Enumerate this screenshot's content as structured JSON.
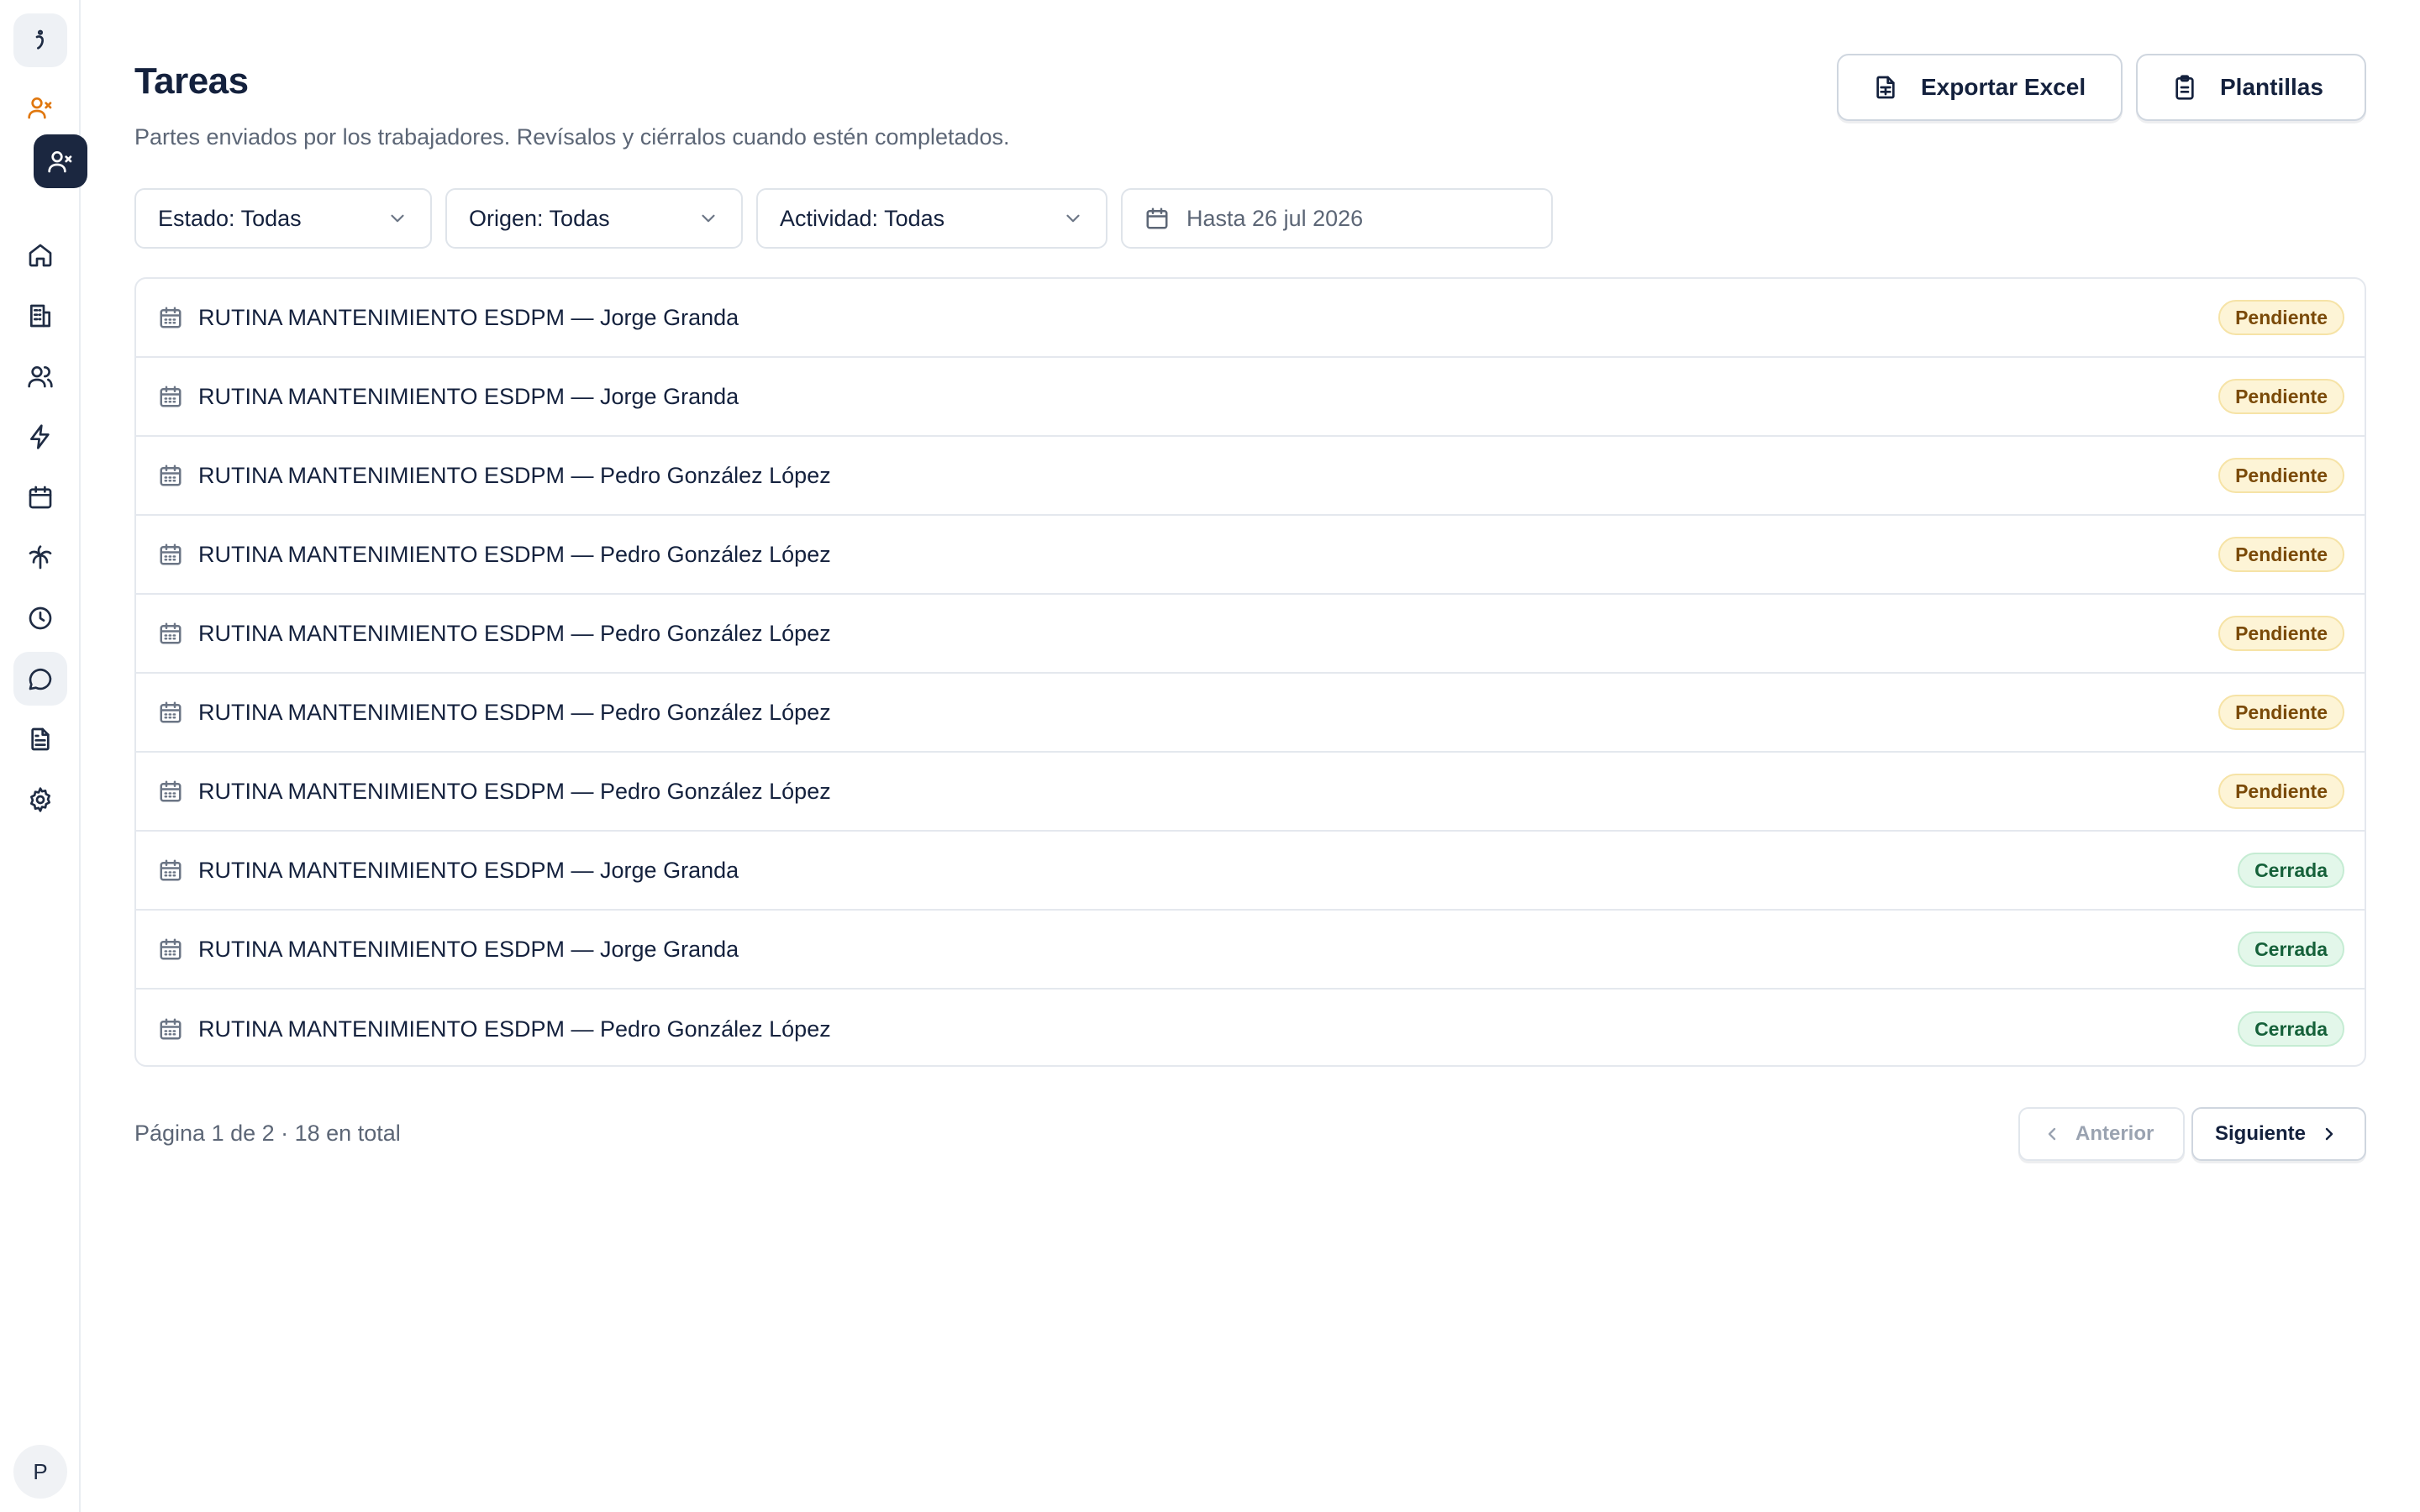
{
  "sidebar": {
    "avatar_initial": "P"
  },
  "header": {
    "title": "Tareas",
    "subtitle": "Partes enviados por los trabajadores. Revísalos y ciérralos cuando estén completados.",
    "export_label": "Exportar Excel",
    "templates_label": "Plantillas"
  },
  "filters": {
    "estado": "Estado: Todas",
    "origen": "Origen: Todas",
    "actividad": "Actividad: Todas",
    "fecha": "Hasta 26 jul 2026"
  },
  "tasks": [
    {
      "title": "RUTINA MANTENIMIENTO ESDPM — Jorge Granda",
      "status": "Pendiente"
    },
    {
      "title": "RUTINA MANTENIMIENTO ESDPM — Jorge Granda",
      "status": "Pendiente"
    },
    {
      "title": "RUTINA MANTENIMIENTO ESDPM — Pedro González López",
      "status": "Pendiente"
    },
    {
      "title": "RUTINA MANTENIMIENTO ESDPM — Pedro González López",
      "status": "Pendiente"
    },
    {
      "title": "RUTINA MANTENIMIENTO ESDPM — Pedro González López",
      "status": "Pendiente"
    },
    {
      "title": "RUTINA MANTENIMIENTO ESDPM — Pedro González López",
      "status": "Pendiente"
    },
    {
      "title": "RUTINA MANTENIMIENTO ESDPM — Pedro González López",
      "status": "Pendiente"
    },
    {
      "title": "RUTINA MANTENIMIENTO ESDPM — Jorge Granda",
      "status": "Cerrada"
    },
    {
      "title": "RUTINA MANTENIMIENTO ESDPM — Jorge Granda",
      "status": "Cerrada"
    },
    {
      "title": "RUTINA MANTENIMIENTO ESDPM — Pedro González López",
      "status": "Cerrada"
    }
  ],
  "pagination": {
    "summary": "Página 1 de 2 · 18 en total",
    "prev_label": "Anterior",
    "next_label": "Siguiente"
  },
  "colors": {
    "pending_bg": "#fdf4d6",
    "pending_text": "#7a4a08",
    "closed_bg": "#e3f7ea",
    "closed_text": "#16613a",
    "nav_dark": "#1b2740",
    "alert_orange": "#e0770e"
  }
}
